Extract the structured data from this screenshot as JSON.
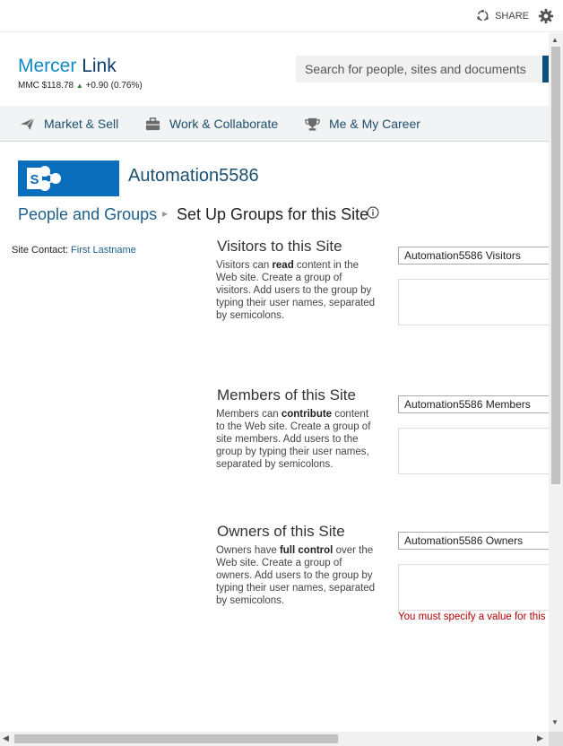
{
  "topbar": {
    "share_label": "SHARE"
  },
  "header": {
    "logo_part1": "Mercer",
    "logo_part2": "Link",
    "stock_prefix": "MMC $118.78",
    "stock_arrow": "▲",
    "stock_change": "+0.90 (0.76%)",
    "search_placeholder": "Search for people, sites and documents"
  },
  "nav": {
    "items": [
      {
        "label": "Market & Sell",
        "icon": "paper-plane-icon"
      },
      {
        "label": "Work & Collaborate",
        "icon": "briefcase-icon"
      },
      {
        "label": "Me & My Career",
        "icon": "trophy-icon"
      }
    ]
  },
  "site": {
    "title": "Automation5586"
  },
  "breadcrumb": {
    "parent": "People and Groups",
    "current": "Set Up Groups for this Site"
  },
  "site_contact": {
    "label": "Site Contact:",
    "name": "First Lastname"
  },
  "sections": [
    {
      "title": "Visitors to this Site",
      "desc_pre": "Visitors can ",
      "desc_bold": "read",
      "desc_post": " content in the Web site. Create a group of visitors. Add users to the group by typing their user names, separated by semicolons.",
      "group_name": "Automation5586 Visitors"
    },
    {
      "title": "Members of this Site",
      "desc_pre": "Members can ",
      "desc_bold": "contribute",
      "desc_post": " content to the Web site. Create a group of site members. Add users to the group by typing their user names, separated by semicolons.",
      "group_name": "Automation5586 Members"
    },
    {
      "title": "Owners of this Site",
      "desc_pre": "Owners have ",
      "desc_bold": "full control",
      "desc_post": " over the Web site. Create a group of owners. Add users to the group by typing their user names, separated by semicolons.",
      "group_name": "Automation5586 Owners"
    }
  ],
  "error_message": "You must specify a value for this required field."
}
